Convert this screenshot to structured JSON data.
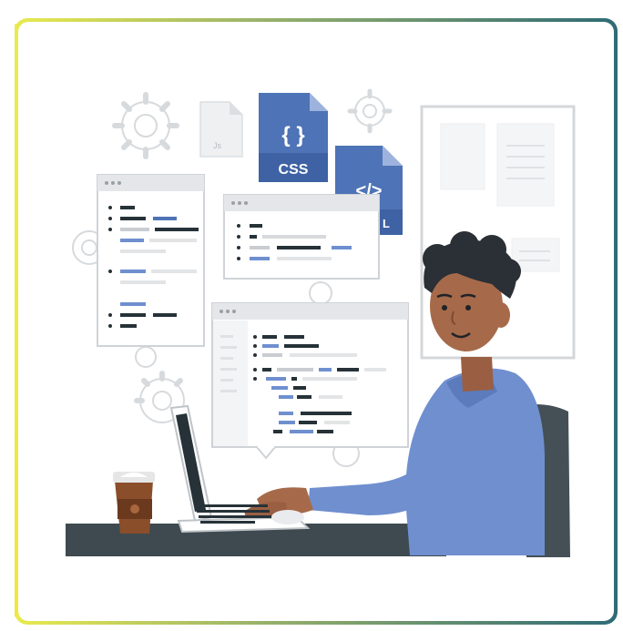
{
  "illustration": {
    "css_file_label": "CSS",
    "css_file_braces": "{ }",
    "html_file_symbol": "</>",
    "html_file_label_partial": "L",
    "small_file_label": "Js",
    "colors": {
      "card_gradient_start": "#e9ea4f",
      "card_gradient_end": "#2f6b76",
      "file_blue": "#4e73b6",
      "shirt_blue": "#6f8fcf",
      "skin": "#a66a4a",
      "hair": "#2b2f36",
      "desk": "#3e4a50",
      "chair": "#455056",
      "code_dark": "#263238",
      "code_blue": "#6f8fcf",
      "code_gray": "#c9ccd0"
    }
  }
}
